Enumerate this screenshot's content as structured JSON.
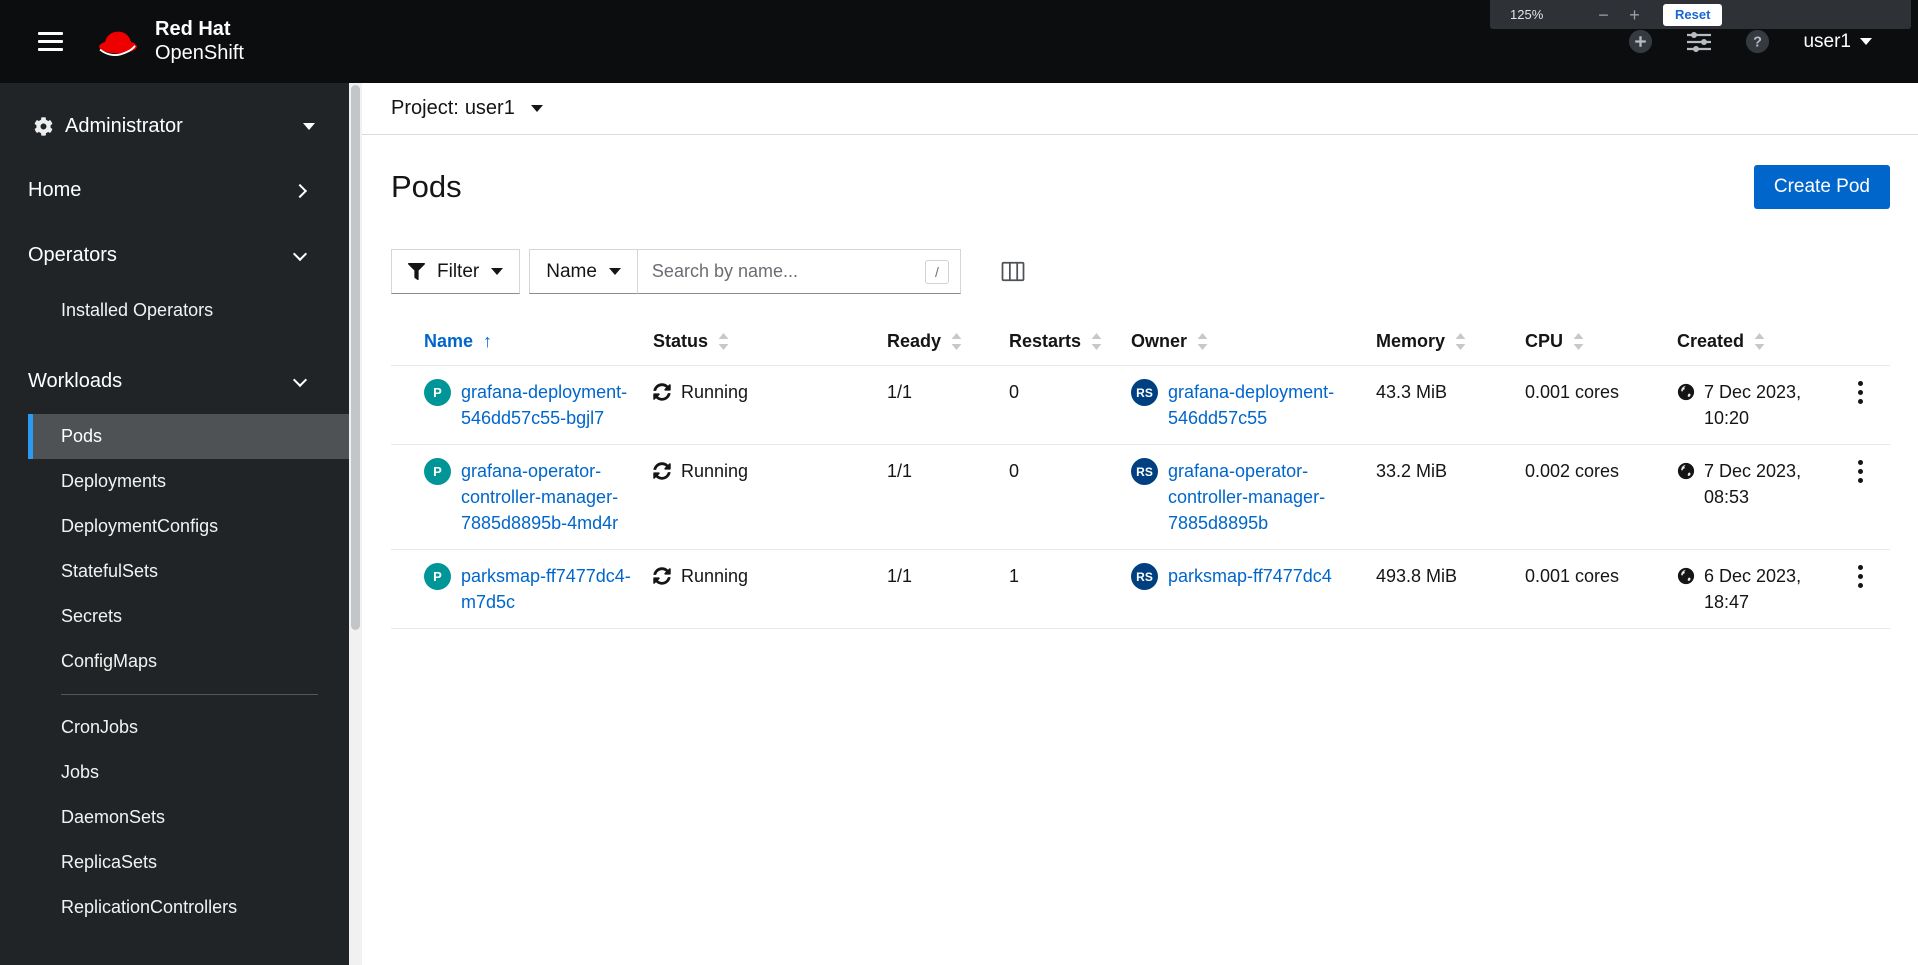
{
  "masthead": {
    "brand_line1": "Red Hat",
    "brand_line2": "OpenShift",
    "username": "user1",
    "zoom": {
      "level": "125%",
      "zoom_out": "−",
      "zoom_in": "+",
      "reset": "Reset"
    }
  },
  "sidebar": {
    "perspective": "Administrator",
    "home": "Home",
    "operators": "Operators",
    "installed_operators": "Installed Operators",
    "workloads": "Workloads",
    "workloads_items": [
      "Pods",
      "Deployments",
      "DeploymentConfigs",
      "StatefulSets",
      "Secrets",
      "ConfigMaps"
    ],
    "workloads_items2": [
      "CronJobs",
      "Jobs",
      "DaemonSets",
      "ReplicaSets",
      "ReplicationControllers"
    ]
  },
  "page": {
    "project_label": "Project:",
    "project_value": "user1",
    "title": "Pods",
    "create_button": "Create Pod"
  },
  "toolbar": {
    "filter_label": "Filter",
    "name_filter_label": "Name",
    "search_placeholder": "Search by name...",
    "search_value": "",
    "shortcut_key": "/"
  },
  "table": {
    "headers": {
      "name": "Name",
      "status": "Status",
      "ready": "Ready",
      "restarts": "Restarts",
      "owner": "Owner",
      "memory": "Memory",
      "cpu": "CPU",
      "created": "Created"
    },
    "rows": [
      {
        "badge": "P",
        "name": "grafana-deployment-546dd57c55-bgjl7",
        "status": "Running",
        "ready": "1/1",
        "restarts": "0",
        "owner_badge": "RS",
        "owner": "grafana-deployment-546dd57c55",
        "memory": "43.3 MiB",
        "cpu": "0.001 cores",
        "created": "7 Dec 2023, 10:20"
      },
      {
        "badge": "P",
        "name": "grafana-operator-controller-manager-7885d8895b-4md4r",
        "status": "Running",
        "ready": "1/1",
        "restarts": "0",
        "owner_badge": "RS",
        "owner": "grafana-operator-controller-manager-7885d8895b",
        "memory": "33.2 MiB",
        "cpu": "0.002 cores",
        "created": "7 Dec 2023, 08:53"
      },
      {
        "badge": "P",
        "name": "parksmap-ff7477dc4-m7d5c",
        "status": "Running",
        "ready": "1/1",
        "restarts": "1",
        "owner_badge": "RS",
        "owner": "parksmap-ff7477dc4",
        "memory": "493.8 MiB",
        "cpu": "0.001 cores",
        "created": "6 Dec 2023, 18:47"
      }
    ]
  },
  "icons": {
    "hamburger": "menu-bars",
    "filter": "funnel",
    "columns": "table-columns",
    "status_running": "sync-arrows",
    "created": "globe",
    "kebab": "three-dots-vertical",
    "sort_asc": "↑",
    "sortable": "up-down-carets"
  },
  "colors": {
    "accent_blue": "#0066cc",
    "link_blue": "#0066cc",
    "pod_badge": "#009596",
    "replicaset_badge": "#004080",
    "masthead_bg": "#0b0d0f",
    "sidebar_bg": "#212427",
    "sidebar_selected_bg": "#4f5255",
    "sidebar_selected_border": "#2b9af3"
  }
}
